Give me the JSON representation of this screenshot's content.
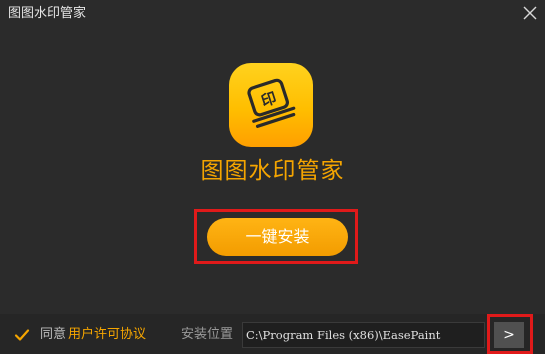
{
  "window": {
    "title": "图图水印管家",
    "close_icon": "close-icon"
  },
  "main": {
    "logo_icon": "stamp-logo-icon",
    "logo_glyph": "印",
    "app_name": "图图水印管家",
    "install_label": "一键安装"
  },
  "footer": {
    "agree_checked": true,
    "agree_label": "同意",
    "license_link": "用户许可协议",
    "path_label": "安装位置",
    "path_value": "C:\\Program Files (x86)\\EasePaint",
    "browse_label": ">"
  },
  "colors": {
    "background": "#2b2b2b",
    "accent": "#f5a500",
    "highlight": "#e01a1a"
  }
}
